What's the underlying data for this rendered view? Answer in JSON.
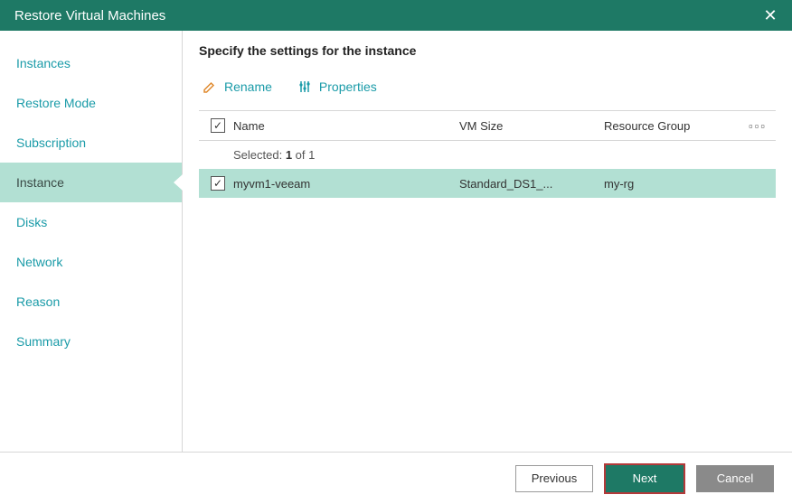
{
  "titlebar": {
    "title": "Restore Virtual Machines"
  },
  "sidebar": {
    "items": [
      {
        "label": "Instances"
      },
      {
        "label": "Restore Mode"
      },
      {
        "label": "Subscription"
      },
      {
        "label": "Instance"
      },
      {
        "label": "Disks"
      },
      {
        "label": "Network"
      },
      {
        "label": "Reason"
      },
      {
        "label": "Summary"
      }
    ]
  },
  "page": {
    "heading": "Specify the settings for the instance"
  },
  "toolbar": {
    "rename_label": "Rename",
    "properties_label": "Properties"
  },
  "table": {
    "columns": {
      "name": "Name",
      "vm_size": "VM Size",
      "resource_group": "Resource Group"
    },
    "selected_prefix": "Selected: ",
    "selected_bold": "1",
    "selected_suffix": " of 1",
    "more_icon": "▫▫▫",
    "rows": [
      {
        "name": "myvm1-veeam",
        "vm_size": "Standard_DS1_...",
        "resource_group": "my-rg"
      }
    ]
  },
  "footer": {
    "previous_label": "Previous",
    "next_label": "Next",
    "cancel_label": "Cancel"
  }
}
